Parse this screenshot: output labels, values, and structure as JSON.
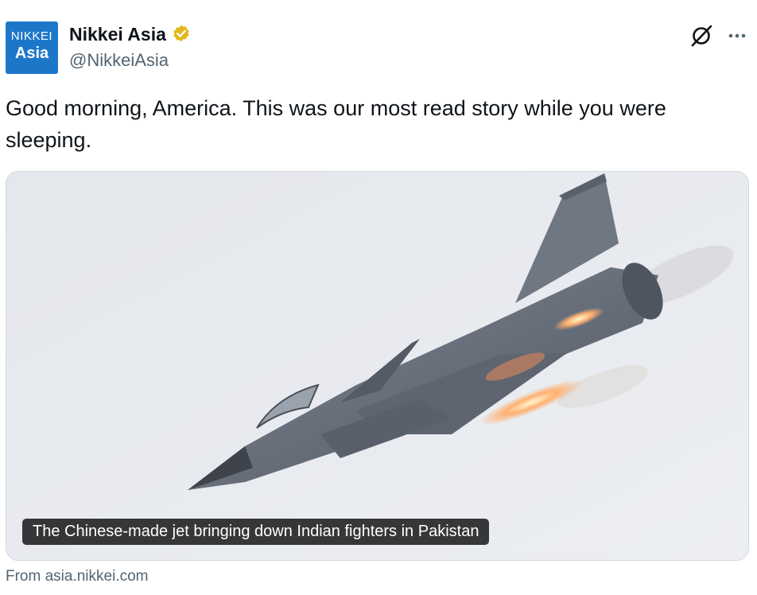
{
  "tweet": {
    "avatar": {
      "line1": "NIKKEI",
      "line2": "Asia"
    },
    "author_name": "Nikkei Asia",
    "handle": "@NikkeiAsia",
    "text": "Good morning, America. This was our most read story while you were sleeping."
  },
  "card": {
    "image": "fighter-jet-firing-missiles-photo",
    "caption": "The Chinese-made jet bringing down Indian fighters in Pakistan",
    "source": "From asia.nikkei.com"
  },
  "icons": {
    "verified": "verified-gold-badge-icon",
    "grok": "grok-icon",
    "more": "more-options-icon"
  },
  "colors": {
    "brand_blue": "#1d77c9",
    "verified_gold": "#e2b719",
    "text_primary": "#0f1419",
    "text_secondary": "#536471",
    "card_border": "#cfd9de"
  }
}
